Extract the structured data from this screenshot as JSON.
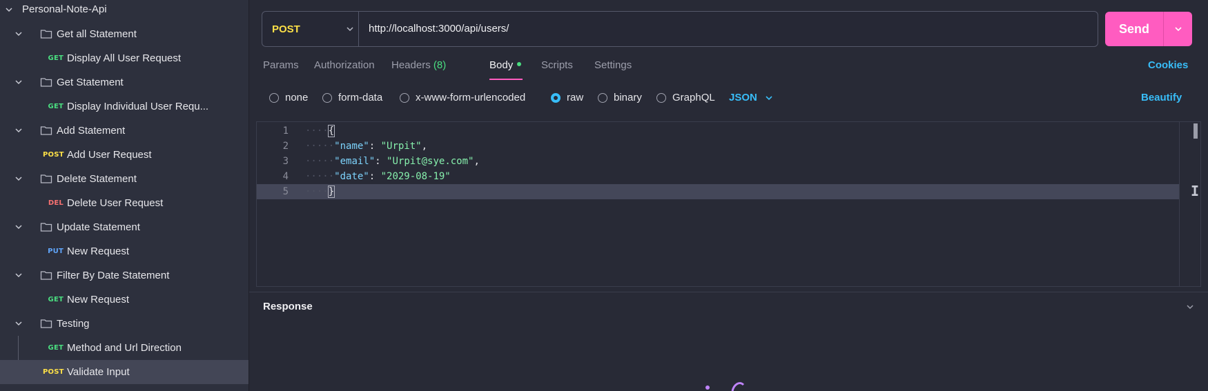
{
  "sidebar": {
    "collection": "Personal-Note-Api",
    "folders": [
      {
        "name": "Get all Statement",
        "requests": [
          {
            "method": "GET",
            "name": "Display All User Request"
          }
        ]
      },
      {
        "name": "Get Statement",
        "requests": [
          {
            "method": "GET",
            "name": "Display Individual User Requ..."
          }
        ]
      },
      {
        "name": "Add Statement",
        "requests": [
          {
            "method": "POST",
            "name": "Add User Request"
          }
        ]
      },
      {
        "name": "Delete Statement",
        "requests": [
          {
            "method": "DEL",
            "name": "Delete User Request"
          }
        ]
      },
      {
        "name": "Update Statement",
        "requests": [
          {
            "method": "PUT",
            "name": "New Request"
          }
        ]
      },
      {
        "name": "Filter By Date Statement",
        "requests": [
          {
            "method": "GET",
            "name": "New Request"
          }
        ]
      },
      {
        "name": "Testing",
        "requests": [
          {
            "method": "GET",
            "name": "Method and Url Direction"
          },
          {
            "method": "POST",
            "name": "Validate Input"
          }
        ]
      }
    ],
    "selected_request": "Validate Input"
  },
  "request": {
    "method": "POST",
    "url": "http://localhost:3000/api/users/",
    "send_label": "Send"
  },
  "tabs": {
    "params": "Params",
    "authorization": "Authorization",
    "headers": "Headers",
    "headers_count": "(8)",
    "body": "Body",
    "scripts": "Scripts",
    "settings": "Settings",
    "active": "Body",
    "cookies": "Cookies"
  },
  "body_types": {
    "none": "none",
    "form_data": "form-data",
    "urlencoded": "x-www-form-urlencoded",
    "raw": "raw",
    "binary": "binary",
    "graphql": "GraphQL",
    "selected": "raw",
    "format": "JSON",
    "beautify": "Beautify"
  },
  "editor": {
    "line_numbers": [
      "1",
      "2",
      "3",
      "4",
      "5"
    ],
    "open_brace": "{",
    "close_brace": "}",
    "fields": [
      {
        "key": "\"name\"",
        "value": "\"Urpit\"",
        "trail": ","
      },
      {
        "key": "\"email\"",
        "value": "\"Urpit@sye.com\"",
        "trail": ","
      },
      {
        "key": "\"date\"",
        "value": "\"2029-08-19\"",
        "trail": ""
      }
    ]
  },
  "response": {
    "title": "Response"
  },
  "colors": {
    "accent": "#ff5cc0",
    "link": "#38bdf8",
    "get": "#4ade80",
    "post": "#fde047",
    "delete": "#f87171",
    "put": "#60a5fa"
  }
}
